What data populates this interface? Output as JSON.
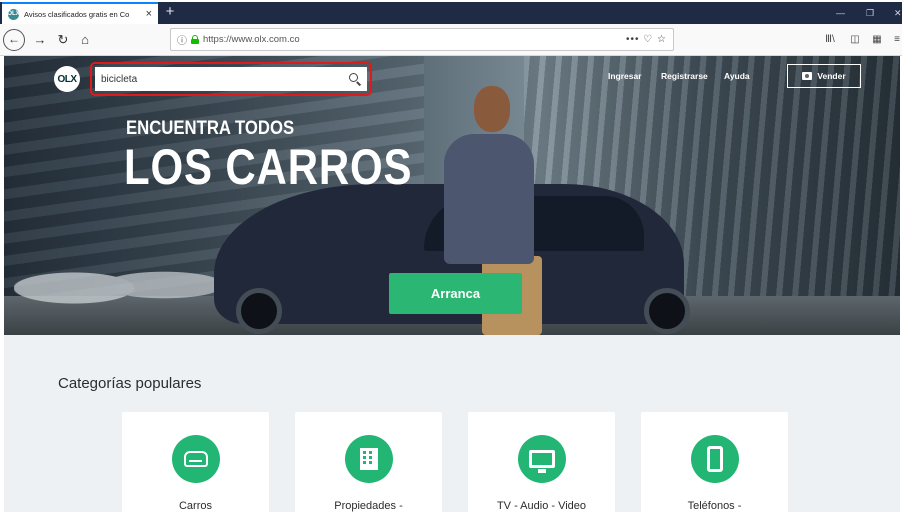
{
  "browser": {
    "tab_title": "Avisos clasificados gratis en Co",
    "tab_favicon": "OLX",
    "url": "https://www.olx.com.co",
    "url_actions": "••• ♡ ☆"
  },
  "header": {
    "logo": "OLX",
    "search_value": "bicicleta",
    "links": [
      "Ingresar",
      "Registrarse",
      "Ayuda"
    ],
    "sell_label": "Vender"
  },
  "hero": {
    "line1": "ENCUENTRA TODOS",
    "line2": "LOS CARROS",
    "cta_label": "Arranca"
  },
  "categories": {
    "heading": "Categorías populares",
    "items": [
      {
        "label": "Carros",
        "icon": "car-icon"
      },
      {
        "label": "Propiedades -",
        "icon": "building-icon"
      },
      {
        "label": "TV - Audio - Video",
        "icon": "tv-icon"
      },
      {
        "label": "Teléfonos -",
        "icon": "phone-icon"
      }
    ]
  },
  "colors": {
    "accent_green": "#23b574",
    "highlight_red": "#e01a1a",
    "tab_bar": "#1f2a44"
  }
}
